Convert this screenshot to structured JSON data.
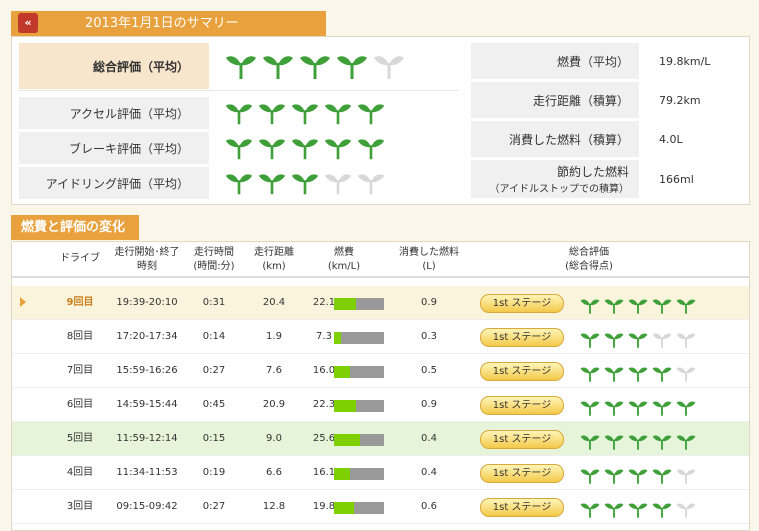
{
  "header": {
    "title": "2013年1月1日のサマリー",
    "back_icon": "double-chevron-left-icon"
  },
  "summary": {
    "overall": {
      "label": "総合評価（平均）",
      "score": 4
    },
    "accel": {
      "label": "アクセル評価（平均）",
      "score": 5
    },
    "brake": {
      "label": "ブレーキ評価（平均）",
      "score": 5
    },
    "idling": {
      "label": "アイドリング評価（平均）",
      "score": 3
    },
    "fuel_economy": {
      "label": "燃費（平均）",
      "value": "19.8km/L"
    },
    "distance": {
      "label": "走行距離（積算）",
      "value": "79.2km"
    },
    "fuel_used": {
      "label": "消費した燃料（積算）",
      "value": "4.0L"
    },
    "fuel_saved": {
      "label": "節約した燃料",
      "sublabel": "（アイドルストップでの積算）",
      "value": "166ml"
    }
  },
  "change_section": {
    "title": "燃費と評価の変化"
  },
  "table": {
    "headers": {
      "drive": "ドライブ",
      "time_l1": "走行開始･終了",
      "time_l2": "時刻",
      "duration_l1": "走行時間",
      "duration_l2": "(時間:分)",
      "distance_l1": "走行距離",
      "distance_l2": "(km)",
      "economy_l1": "燃費",
      "economy_l2": "(km/L)",
      "fuel_l1": "消費した燃料",
      "fuel_l2": "(L)",
      "overall_l1": "総合評価",
      "overall_l2": "(総合得点)"
    },
    "stage_label": "1st ステージ",
    "rows": [
      {
        "drive": "9回目",
        "time": "19:39-20:10",
        "duration": "0:31",
        "distance": "20.4",
        "economy": "22.1",
        "fuel": "0.9",
        "score": 5,
        "selected": true
      },
      {
        "drive": "8回目",
        "time": "17:20-17:34",
        "duration": "0:14",
        "distance": "1.9",
        "economy": "7.3",
        "fuel": "0.3",
        "score": 3
      },
      {
        "drive": "7回目",
        "time": "15:59-16:26",
        "duration": "0:27",
        "distance": "7.6",
        "economy": "16.0",
        "fuel": "0.5",
        "score": 4
      },
      {
        "drive": "6回目",
        "time": "14:59-15:44",
        "duration": "0:45",
        "distance": "20.9",
        "economy": "22.3",
        "fuel": "0.9",
        "score": 5
      },
      {
        "drive": "5回目",
        "time": "11:59-12:14",
        "duration": "0:15",
        "distance": "9.0",
        "economy": "25.6",
        "fuel": "0.4",
        "score": 5,
        "best": true
      },
      {
        "drive": "4回目",
        "time": "11:34-11:53",
        "duration": "0:19",
        "distance": "6.6",
        "economy": "16.1",
        "fuel": "0.4",
        "score": 4
      },
      {
        "drive": "3回目",
        "time": "09:15-09:42",
        "duration": "0:27",
        "distance": "12.8",
        "economy": "19.8",
        "fuel": "0.6",
        "score": 4
      }
    ],
    "economy_scale_max": 50
  },
  "colors": {
    "accent": "#e8a13c",
    "sprout_on": "#3fa03a",
    "sprout_off": "#d8d8d8",
    "bar_fill": "#7ed000"
  },
  "icons": {
    "rating": "sprout-icon",
    "selected_row": "play-arrow-icon"
  }
}
